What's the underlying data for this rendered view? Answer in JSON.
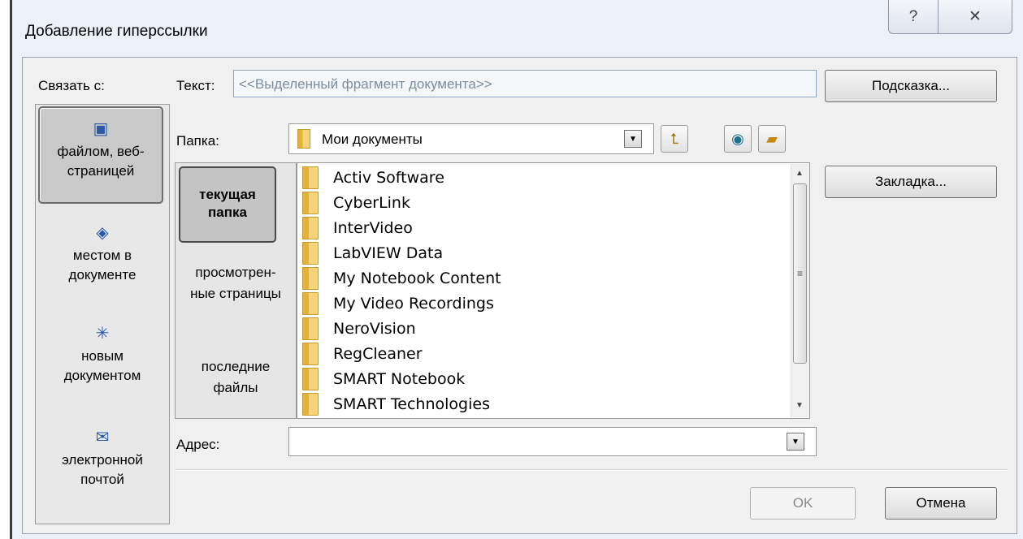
{
  "window": {
    "title": "Добавление гиперссылки",
    "help_glyph": "?",
    "close_glyph": "✕"
  },
  "link_to": {
    "label": "Связать с:",
    "items": [
      {
        "label": "файлом, веб-страницей",
        "icon": "file-web-page-icon"
      },
      {
        "label": "местом в документе",
        "icon": "place-in-document-icon"
      },
      {
        "label": "новым документом",
        "icon": "new-document-icon"
      },
      {
        "label": "электронной почтой",
        "icon": "email-icon"
      }
    ]
  },
  "text_field": {
    "label": "Текст:",
    "value": "<<Выделенный фрагмент документа>>"
  },
  "buttons": {
    "tooltip": "Подсказка...",
    "bookmark": "Закладка...",
    "ok": "OK",
    "cancel": "Отмена"
  },
  "folder": {
    "label": "Папка:",
    "value": "Мои документы"
  },
  "places": [
    {
      "label": "текущая папка"
    },
    {
      "label": "просмотрен-ные страницы"
    },
    {
      "label": "последние файлы"
    }
  ],
  "files": [
    "Activ Software",
    "CyberLink",
    "InterVideo",
    "LabVIEW Data",
    "My Notebook Content",
    "My Video Recordings",
    "NeroVision",
    "RegCleaner",
    "SMART Notebook",
    "SMART Technologies"
  ],
  "address": {
    "label": "Адрес:",
    "value": ""
  },
  "colors": {
    "frame": "#ecf1f8",
    "client": "#f0f0f0",
    "selected": "#c4c4c4"
  }
}
